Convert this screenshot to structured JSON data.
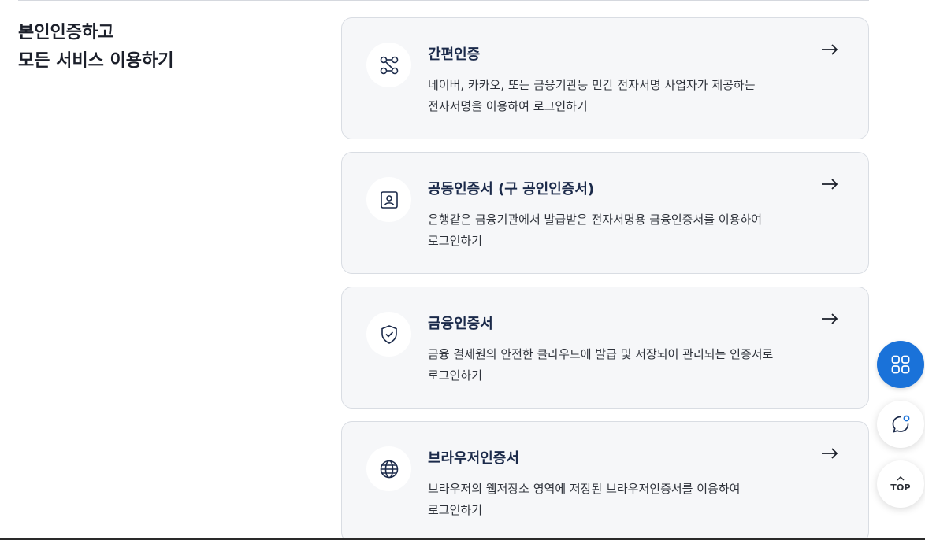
{
  "heading": {
    "line1": "본인인증하고",
    "line2": "모든 서비스 이용하기"
  },
  "cards": [
    {
      "title": "간편인증",
      "desc_line1": "네이버, 카카오, 또는 금융기관등 민간 전자서명 사업자가 제공하는",
      "desc_line2": "전자서명을 이용하여 로그인하기",
      "icon": "nodes-link-icon"
    },
    {
      "title": "공동인증서 (구 공인인증서)",
      "desc_line1": "은행같은 금융기관에서 발급받은 전자서명용 금융인증서를 이용하여",
      "desc_line2": "로그인하기",
      "icon": "id-card-icon"
    },
    {
      "title": "금융인증서",
      "desc_line1": "금융 결제원의 안전한 클라우드에 발급 및 저장되어 관리되는 인증서로",
      "desc_line2": "로그인하기",
      "icon": "shield-check-icon"
    },
    {
      "title": "브라우저인증서",
      "desc_line1": "브라우저의 웹저장소 영역에 저장된 브라우저인증서를 이용하여",
      "desc_line2": "로그인하기",
      "icon": "globe-icon"
    }
  ],
  "floating": {
    "top_label": "TOP"
  },
  "colors": {
    "accent": "#1a72d9",
    "card_bg": "#f6f7f9",
    "title": "#1b2a4a"
  }
}
